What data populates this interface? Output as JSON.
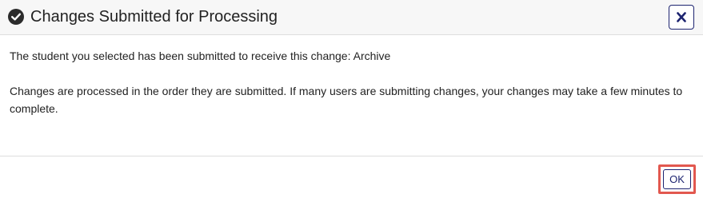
{
  "dialog": {
    "title": "Changes Submitted for Processing",
    "title_icon": "check-circle-icon",
    "close_icon": "close-icon",
    "message_line1": "The student you selected has been submitted to receive this change: Archive",
    "message_line2": "Changes are processed in the order they are submitted. If many users are submitting changes, your changes may take a few minutes to complete.",
    "ok_label": "OK"
  },
  "colors": {
    "accent": "#1d2470",
    "highlight": "#e2584f",
    "header_bg": "#f7f7f7",
    "divider": "#dedede"
  }
}
